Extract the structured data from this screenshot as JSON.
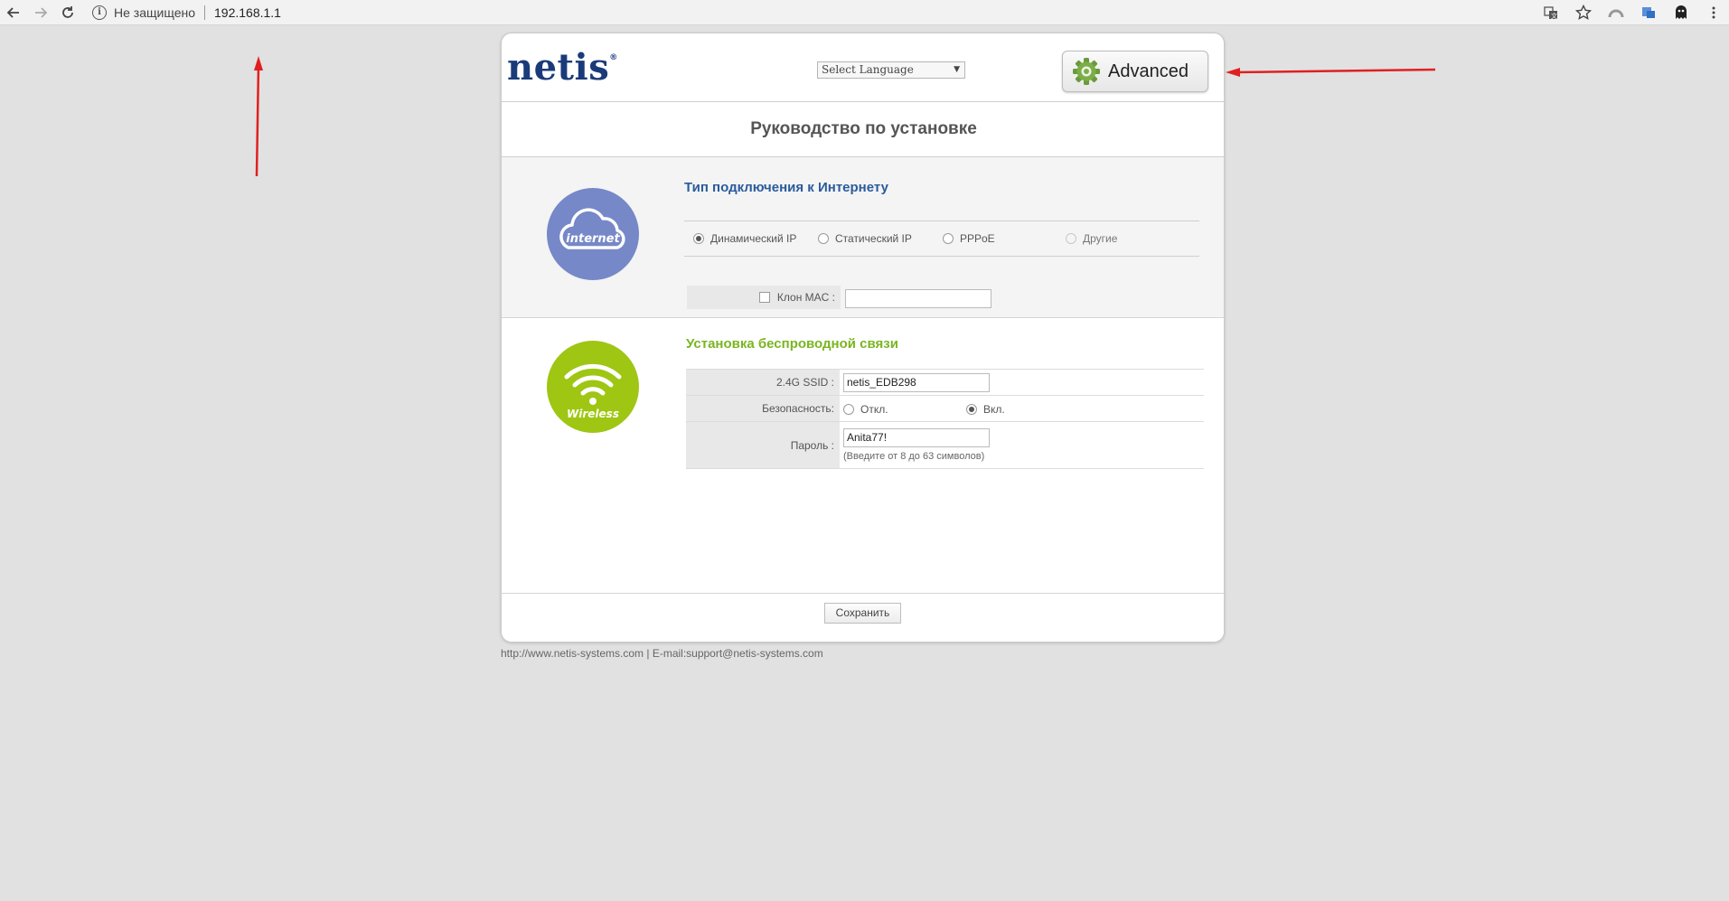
{
  "browser": {
    "security_label": "Не защищено",
    "url": "192.168.1.1"
  },
  "header": {
    "logo": "netis",
    "logo_mark": "®",
    "language": "Select Language",
    "advanced_label": "Advanced"
  },
  "page_title": "Руководство по установке",
  "internet": {
    "icon_label": "internet",
    "title": "Тип подключения к Интернету",
    "options": [
      {
        "label": "Динамический IP",
        "selected": true
      },
      {
        "label": "Статический IP",
        "selected": false
      },
      {
        "label": "PPPoE",
        "selected": false
      },
      {
        "label": "Другие",
        "selected": false,
        "disabled": true
      }
    ],
    "mac_clone_label": "Клон MAC :",
    "mac_value": ""
  },
  "wireless": {
    "icon_label": "Wireless",
    "title": "Установка беспроводной связи",
    "ssid_label": "2.4G SSID :",
    "ssid_value": "netis_EDB298",
    "security_label": "Безопасность:",
    "security_off": "Откл.",
    "security_on": "Вкл.",
    "password_label": "Пароль :",
    "password_value": "Anita77!",
    "password_hint": "(Введите от 8 до 63 символов)"
  },
  "save_label": "Сохранить",
  "footer": "http://www.netis-systems.com | E-mail:support@netis-systems.com",
  "colors": {
    "annotation_arrow": "#e02020",
    "internet_circle": "#7688c8",
    "wireless_circle": "#9ec613",
    "internet_title": "#2a5c9c",
    "wireless_title": "#7ab520"
  }
}
